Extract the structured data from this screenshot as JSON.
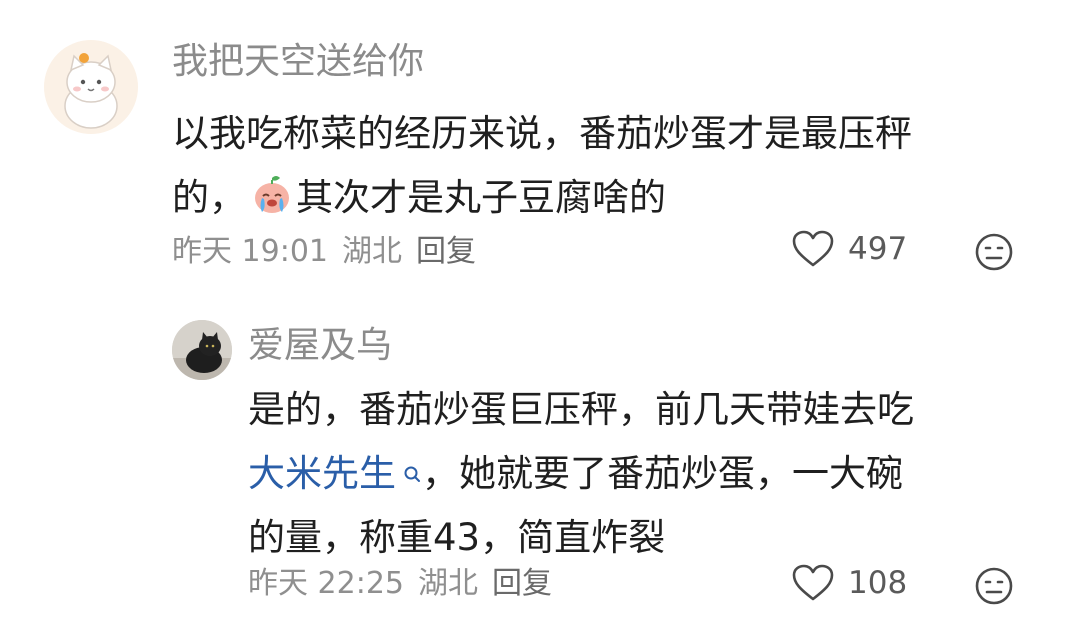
{
  "comments": [
    {
      "username": "我把天空送给你",
      "text_line1": "以我吃称菜的经历来说，番茄炒蛋才是最压秤",
      "text_line2_a": "的，",
      "text_line2_b": "其次才是丸子豆腐啥的",
      "emoji": "crying-peach-emoji",
      "time": "昨天 19:01",
      "location": "湖北",
      "reply_label": "回复",
      "likes": "497"
    },
    {
      "username": "爱屋及乌",
      "text_line1": "是的，番茄炒蛋巨压秤，前几天带娃去吃",
      "link_text": "大米先生",
      "text_line2_rest": "，她就要了番茄炒蛋，一大碗",
      "text_line3": "的量，称重43，简直炸裂",
      "time": "昨天 22:25",
      "location": "湖北",
      "reply_label": "回复",
      "likes": "108"
    }
  ],
  "colors": {
    "username": "#8b8b8b",
    "body_text": "#1f1f1f",
    "meta": "#8f8f8f",
    "link": "#2a5ea8"
  }
}
